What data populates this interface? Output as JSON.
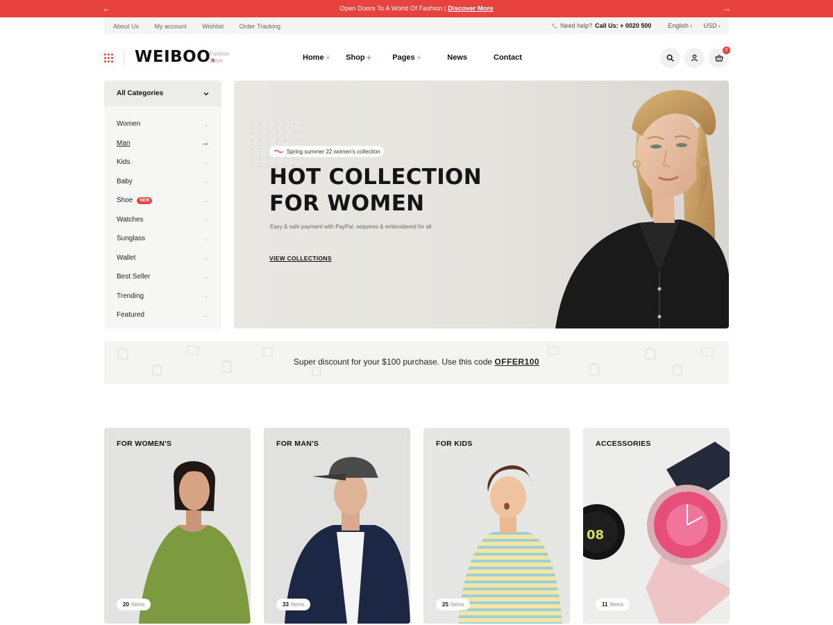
{
  "announcement": {
    "message": "Open Doors To A World Of Fashion |",
    "link": "Discover More"
  },
  "utility": {
    "links": [
      "About Us",
      "My account",
      "Wishlist",
      "Order Tracking"
    ],
    "help_label": "Need help?",
    "call_label": "Call Us: + 0020 500",
    "language": "English",
    "currency": "USD"
  },
  "header": {
    "logo": "WEIBOO",
    "logo_sub_1": "Fashion",
    "logo_sub_2": "Store",
    "nav": [
      {
        "label": "Home",
        "has_plus": true
      },
      {
        "label": "Shop",
        "has_plus": true
      },
      {
        "label": "Pages",
        "has_plus": true
      },
      {
        "label": "News",
        "has_plus": false
      },
      {
        "label": "Contact",
        "has_plus": false
      }
    ],
    "cart_count": "0",
    "icons": [
      "grid-icon",
      "search-icon",
      "user-icon",
      "basket-icon"
    ]
  },
  "sidebar": {
    "title": "All Categories",
    "items": [
      {
        "label": "Women"
      },
      {
        "label": "Man",
        "active": true
      },
      {
        "label": "Kids"
      },
      {
        "label": "Baby"
      },
      {
        "label": "Shoe",
        "badge": "NEW"
      },
      {
        "label": "Watches"
      },
      {
        "label": "Sunglass"
      },
      {
        "label": "Wallet"
      },
      {
        "label": "Best Seller"
      },
      {
        "label": "Trending"
      },
      {
        "label": "Featured"
      }
    ]
  },
  "hero": {
    "tag": "Spring summer 22 women's collection",
    "title_line1": "HOT COLLECTION",
    "title_line2": "FOR WOMEN",
    "description": "Easy & safe payment with PayPal. sequines & embroidered for all",
    "cta": "VIEW COLLECTIONS"
  },
  "discount": {
    "text": "Super discount for your $100 purchase. Use this code",
    "code": "OFFER100"
  },
  "categories": [
    {
      "title": "FOR WOMEN'S",
      "count": "20",
      "unit": "Items"
    },
    {
      "title": "FOR MAN'S",
      "count": "33",
      "unit": "Items"
    },
    {
      "title": "FOR KIDS",
      "count": "25",
      "unit": "Items"
    },
    {
      "title": "ACCESSORIES",
      "count": "11",
      "unit": "Items"
    }
  ],
  "colors": {
    "accent": "#e8423f",
    "text": "#111111",
    "panel": "#f6f6f4"
  }
}
